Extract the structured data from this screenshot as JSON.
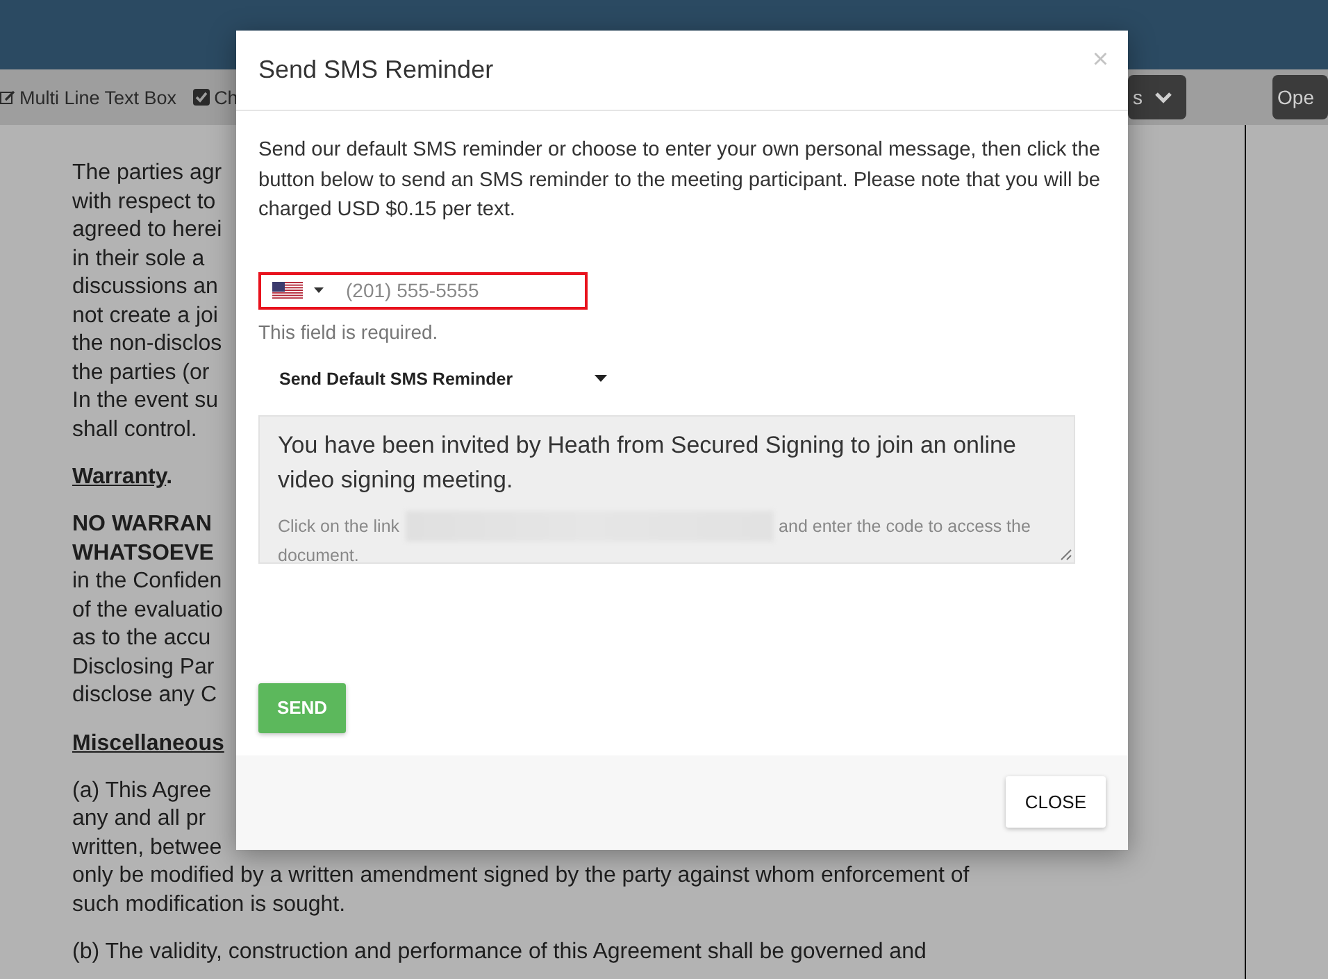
{
  "toolbar": {
    "items": [
      {
        "label": "Multi Line Text Box",
        "kind": "edit"
      },
      {
        "label": "Ch",
        "kind": "checkbox"
      }
    ],
    "buttons": [
      {
        "label": "s",
        "kind": "dropdown"
      },
      {
        "label": "Ope",
        "kind": "plain"
      }
    ]
  },
  "document": {
    "blocks": [
      {
        "kind": "para",
        "lines": [
          {
            "text": "The parties agr",
            "bold": false
          },
          {
            "text": "with respect to",
            "bold": false
          },
          {
            "text": "agreed to herei",
            "bold": false
          },
          {
            "text": "in their sole a",
            "bold": false
          },
          {
            "text": "discussions an",
            "bold": false
          },
          {
            "text": "not create a joi",
            "bold": false
          },
          {
            "text": "the non-disclos",
            "bold": false
          },
          {
            "text": "the parties (or",
            "bold": false
          },
          {
            "text": "In the event su",
            "bold": false
          },
          {
            "text": "shall control.",
            "bold": false
          }
        ]
      },
      {
        "kind": "heading",
        "text": "Warranty",
        "suffix": "."
      },
      {
        "kind": "para",
        "lines": [
          {
            "text": "NO WARRAN",
            "bold": true
          },
          {
            "text": "WHATSOEVE",
            "bold": true
          },
          {
            "text": "in the Confiden",
            "bold": false
          },
          {
            "text": "of the evaluatio",
            "bold": false
          },
          {
            "text": "as to the accu",
            "bold": false
          },
          {
            "text": "Disclosing Par",
            "bold": false
          },
          {
            "text": "disclose any C",
            "bold": false
          }
        ]
      },
      {
        "kind": "heading",
        "text": "Miscellaneous"
      },
      {
        "kind": "para",
        "lines": [
          {
            "text": "(a) This Agree",
            "bold": false
          },
          {
            "text": "any and all pr",
            "bold": false
          },
          {
            "text": "written, betwee",
            "bold": false
          },
          {
            "text": "only be modified by a written amendment signed by the party against whom enforcement of",
            "bold": false
          },
          {
            "text": "such modification is sought.",
            "bold": false
          }
        ]
      },
      {
        "kind": "para",
        "lines": [
          {
            "text": "(b) The validity, construction and performance of this Agreement shall be governed and",
            "bold": false
          }
        ]
      }
    ]
  },
  "modal": {
    "title": "Send SMS Reminder",
    "close_symbol": "×",
    "intro": "Send our default SMS reminder or choose to enter your own personal message, then click the button below to send an SMS reminder to the meeting participant. Please note that you will be charged USD $0.15 per text.",
    "phone": {
      "placeholder": "(201) 555-5555",
      "invalid": true
    },
    "error": "This field is required.",
    "message_type": "Send Default SMS Reminder",
    "message": {
      "text": "You have been invited by Heath from Secured Signing to join an online video signing meeting.",
      "note_before": "Click on the link",
      "note_after": "and enter the code to access the",
      "note_end": "document."
    },
    "send_button": "SEND",
    "close_button": "CLOSE"
  }
}
